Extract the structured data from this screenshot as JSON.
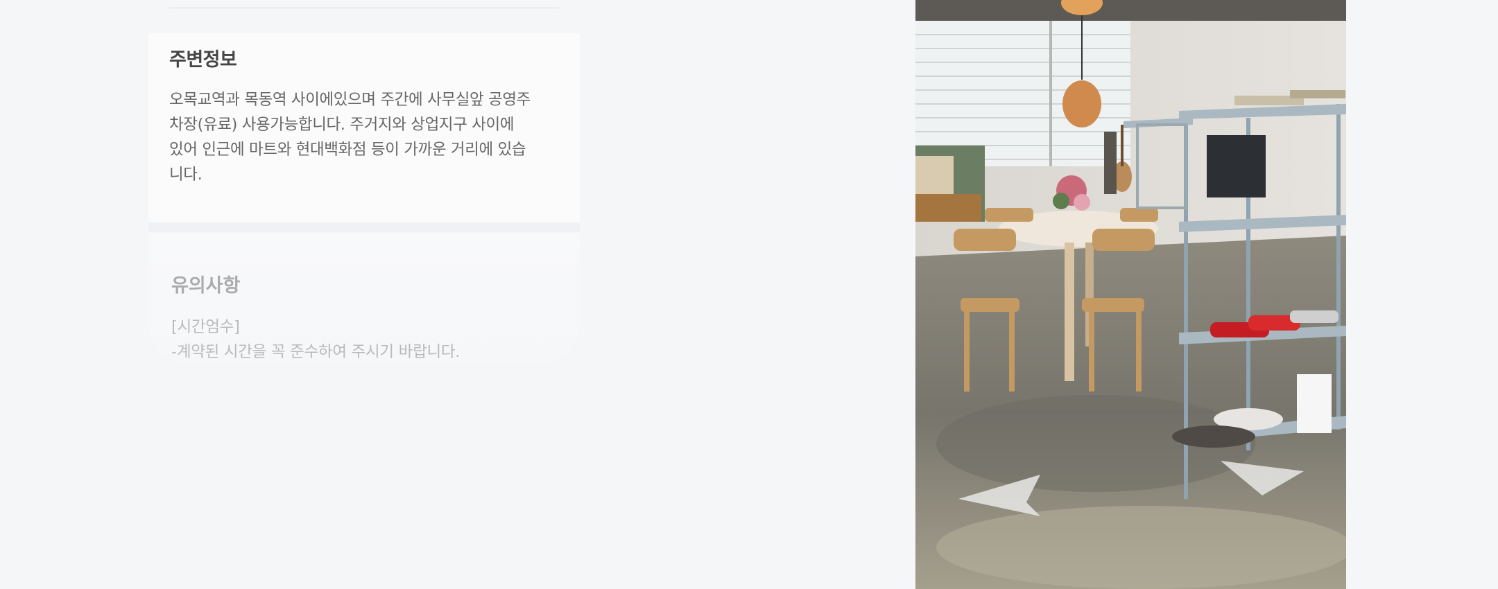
{
  "surroundings": {
    "title": "주변정보",
    "lines": [
      "오목교역과 목동역 사이에있으며 주간에 사무실앞 공영주",
      "차장(유료) 사용가능합니다.  주거지와 상업지구 사이에",
      "있어 인근에 마트와 현대백화점 등이 가까운 거리에 있습",
      "니다."
    ]
  },
  "notice": {
    "title": "유의사항",
    "lines": [
      "[시간엄수]",
      "-계약된 시간을 꼭 준수하여 주시기 바랍니다."
    ]
  },
  "photo": {
    "subject": "studio-interior-photo"
  },
  "colors": {
    "page_background": "#f5f6f8",
    "card_background": "#fbfbfc",
    "title_text": "#454545",
    "body_text": "#666666"
  }
}
